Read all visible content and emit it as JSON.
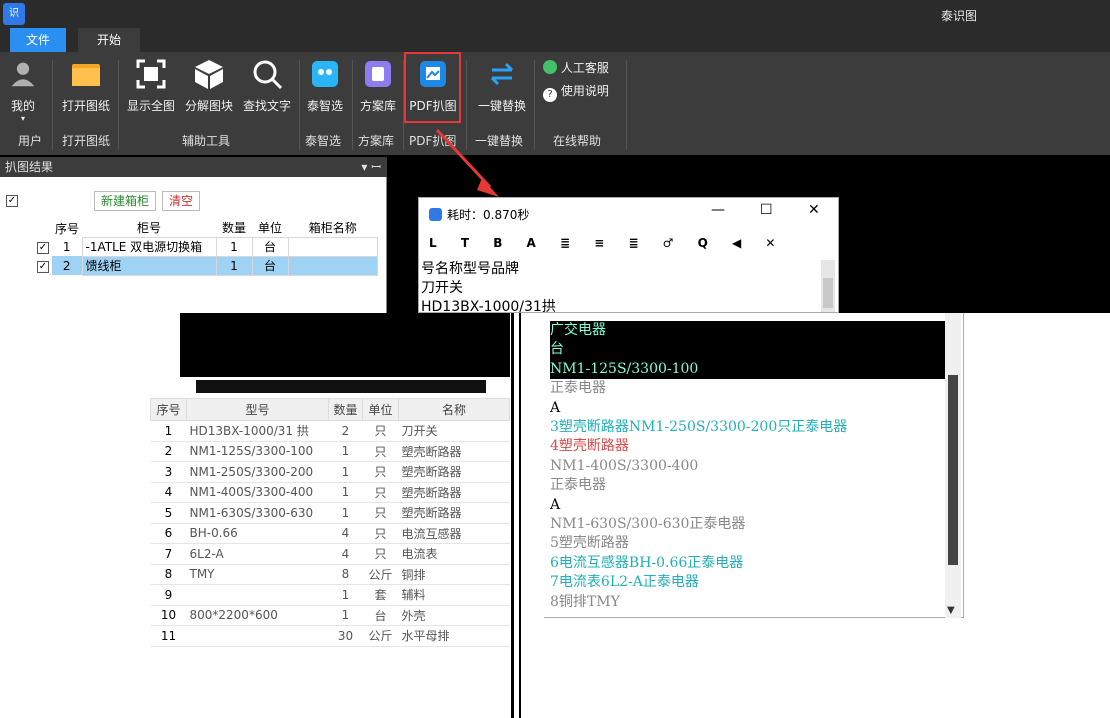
{
  "app": {
    "title": "泰识图",
    "icon_text": "识"
  },
  "menu": {
    "tabs": [
      "文件",
      "开始"
    ]
  },
  "ribbon": {
    "user_label": "我的",
    "open_label": "打开图纸",
    "show_all_label": "显示全图",
    "explode_label": "分解图块",
    "find_text_label": "查找文字",
    "taizhixuan_label": "泰智选",
    "scheme_label": "方案库",
    "pdf_label": "PDF扒图",
    "replace_label": "一键替换",
    "service_label": "人工客服",
    "help_label": "使用说明",
    "groups": [
      "用户",
      "打开图纸",
      "辅助工具",
      "泰智选",
      "方案库",
      "PDF扒图",
      "一键替换",
      "在线帮助"
    ]
  },
  "panel": {
    "title": "扒图结果",
    "pin": "▾ ꟷ",
    "new_cabinet": "新建箱柜",
    "clear": "清空",
    "headers": [
      "序号",
      "柜号",
      "数量",
      "单位",
      "箱柜名称"
    ],
    "rows": [
      {
        "checked": "✓",
        "idx": "1",
        "name": "-1ATLE 双电源切换箱",
        "qty": "1",
        "unit": "台",
        "title": ""
      },
      {
        "checked": "✓",
        "idx": "2",
        "name": "馈线柜",
        "qty": "1",
        "unit": "台",
        "title": ""
      }
    ],
    "header_check": "✓"
  },
  "dialog": {
    "title": "耗时：0.870秒",
    "min": "—",
    "max": "☐",
    "close": "✕",
    "toolbar": "L T B A ≣ ≡ ≣ ♂ Q ◀ ✕",
    "lines": [
      "号名称型号品牌",
      "刀开关",
      "HD13BX-1000/31拱"
    ]
  },
  "list": {
    "headers": [
      "序号",
      "型号",
      "数量",
      "单位",
      "名称"
    ],
    "rows": [
      [
        "1",
        "HD13BX-1000/31 拱",
        "2",
        "只",
        "刀开关"
      ],
      [
        "2",
        "NM1-125S/3300-100",
        "1",
        "只",
        "塑壳断路器"
      ],
      [
        "3",
        "NM1-250S/3300-200",
        "1",
        "只",
        "塑壳断路器"
      ],
      [
        "4",
        "NM1-400S/3300-400",
        "1",
        "只",
        "塑壳断路器"
      ],
      [
        "5",
        "NM1-630S/3300-630",
        "1",
        "只",
        "塑壳断路器"
      ],
      [
        "6",
        "BH-0.66",
        "4",
        "只",
        "电流互感器"
      ],
      [
        "7",
        "6L2-A",
        "4",
        "只",
        "电流表"
      ],
      [
        "8",
        "TMY",
        "8",
        "公斤",
        "铜排"
      ],
      [
        "9",
        "",
        "1",
        "套",
        "辅料"
      ],
      [
        "10",
        "800*2200*600",
        "1",
        "台",
        "外壳"
      ],
      [
        "11",
        "",
        "30",
        "公斤",
        "水平母排"
      ]
    ]
  },
  "ocr": {
    "lines": [
      {
        "t": "广交电器",
        "c": "ln-dark"
      },
      {
        "t": "台",
        "c": "ln-dark"
      },
      {
        "t": "NM1-125S/3300-100",
        "c": "ln-dark"
      },
      {
        "t": "正泰电器",
        "c": "ln-gray"
      },
      {
        "t": "A",
        "c": ""
      },
      {
        "t": "3塑壳断路器NM1-250S/3300-200只正泰电器",
        "c": "ln-cyan"
      },
      {
        "t": "4塑壳断路器",
        "c": "ln-red"
      },
      {
        "t": "NM1-400S/3300-400",
        "c": "ln-gray"
      },
      {
        "t": "正泰电器",
        "c": "ln-gray"
      },
      {
        "t": "A",
        "c": ""
      },
      {
        "t": "NM1-630S/300-630正泰电器",
        "c": "ln-gray"
      },
      {
        "t": "5塑壳断路器",
        "c": "ln-gray"
      },
      {
        "t": "6电流互感器BH-0.66正泰电器",
        "c": "ln-cyan"
      },
      {
        "t": "7电流表6L2-A正泰电器",
        "c": "ln-cyan"
      },
      {
        "t": "8铜排TMY",
        "c": "ln-gray"
      }
    ]
  }
}
